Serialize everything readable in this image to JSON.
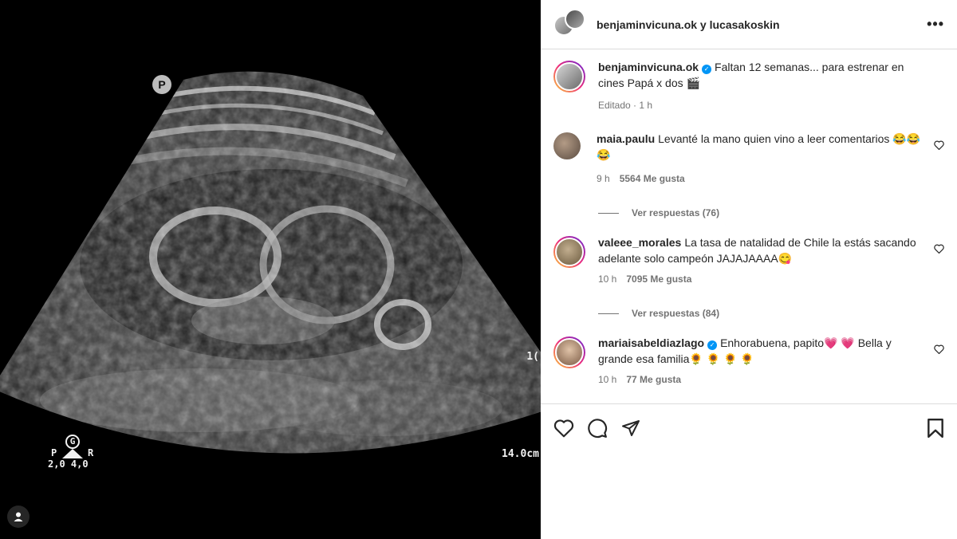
{
  "media": {
    "badge": "P",
    "depth_mark": "1(",
    "depth": "14.0cm",
    "probe": {
      "g": "G",
      "p": "P",
      "r": "R",
      "values": "2,0 4,0"
    }
  },
  "header": {
    "names": "benjaminvicuna.ok y lucasakoskin",
    "more": "•••"
  },
  "caption": {
    "username": "benjaminvicuna.ok",
    "text": "Faltan 12 semanas... para estrenar en cines Papá x dos 🎬",
    "meta": "Editado · 1 h"
  },
  "comments": [
    {
      "username": "maia.paulu",
      "text": "Levanté la mano quien vino a leer comentarios 😂😂😂",
      "time": "9 h",
      "likes": "5564 Me gusta",
      "replies": "Ver respuestas (76)"
    },
    {
      "username": "valeee_morales",
      "text": "La tasa de natalidad de Chile la estás sacando adelante solo campeón JAJAJAAAA😋",
      "time": "10 h",
      "likes": "7095 Me gusta",
      "replies": "Ver respuestas (84)"
    },
    {
      "username": "mariaisabeldiazlago",
      "text": "Enhorabuena, papito💗 💗  Bella y grande esa familia🌻 🌻 🌻 🌻",
      "time": "10 h",
      "likes": "77 Me gusta"
    }
  ],
  "icons": {
    "like": "heart-icon",
    "comment": "comment-icon",
    "share": "share-icon",
    "save": "bookmark-icon",
    "tagged": "user-icon"
  }
}
